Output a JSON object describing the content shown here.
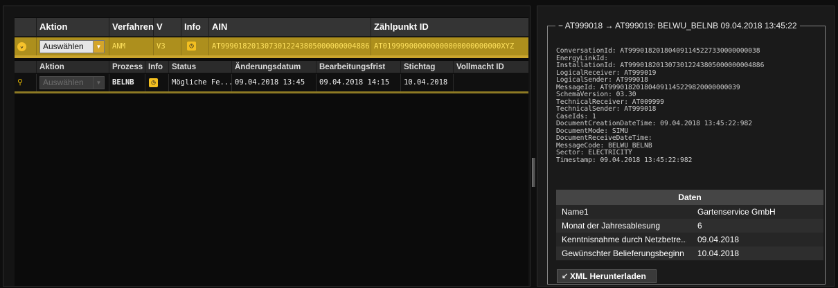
{
  "process_table": {
    "columns": [
      "Aktion",
      "Verfahren",
      "V",
      "Info",
      "AIN",
      "Zählpunkt ID"
    ],
    "row": {
      "aktion": "Auswählen",
      "verfahren": "ANM",
      "version": "V3",
      "ain": "AT9990182013073012243805000000004886",
      "zaehlpunkt_id": "AT019999000000000000000000000XYZ"
    },
    "sub_columns": [
      "Aktion",
      "Prozess",
      "Info",
      "Status",
      "Änderungsdatum",
      "Bearbeitungsfrist",
      "Stichtag",
      "Vollmacht ID"
    ],
    "sub_row": {
      "aktion": "Auswählen",
      "prozess": "BELNB",
      "status": "Mögliche Fe...",
      "aenderungsdatum": "09.04.2018 13:45",
      "bearbeitungsfrist": "09.04.2018 14:15",
      "stichtag": "10.04.2018",
      "vollmacht_id": ""
    }
  },
  "detail": {
    "legend": "AT999018 → AT999019: BELWU_BELNB 09.04.2018 13:45:22",
    "metadata": "ConversationId: AT999018201804091145227330000000038\nEnergyLinkId:\nInstallationId: AT9990182013073012243805000000004886\nLogicalReceiver: AT999019\nLogicalSender: AT999018\nMessageId: AT999018201804091145229820000000039\nSchemaVersion: 03.30\nTechnicalReceiver: AT009999\nTechnicalSender: AT999018\nCaseIds: 1\nDocumentCreationDateTime: 09.04.2018 13:45:22:982\nDocumentMode: SIMU\nDocumentReceiveDateTime:\nMessageCode: BELWU_BELNB\nSector: ELECTRICITY\nTimestamp: 09.04.2018 13:45:22:982",
    "daten_header": "Daten",
    "daten": [
      {
        "key": "Name1",
        "value": "Gartenservice GmbH"
      },
      {
        "key": "Monat der Jahresablesung",
        "value": "6"
      },
      {
        "key": "Kenntnisnahme durch Netzbetre...",
        "value": "09.04.2018"
      },
      {
        "key": "Gewünschter Belieferungsbeginn",
        "value": "10.04.2018"
      }
    ],
    "xml_button": "XML Herunterladen"
  },
  "icons": [
    "expand-icon",
    "dropdown-arrow-icon",
    "clock-icon",
    "search-icon",
    "collapse-icon",
    "download-icon"
  ],
  "colors": {
    "accent": "#f3bf20",
    "row_highlight": "#ad8f1d",
    "highlight_text": "#ffe25e"
  }
}
